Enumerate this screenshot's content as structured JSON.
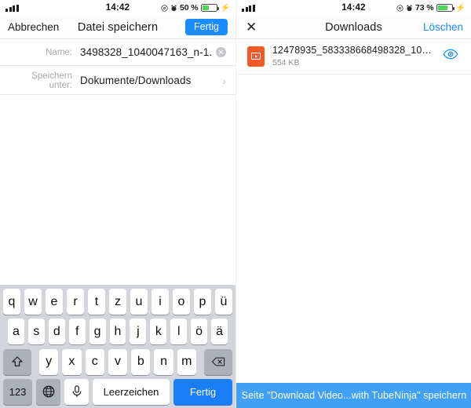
{
  "left": {
    "status": {
      "time": "14:42",
      "battery_pct": "50 %",
      "signal_icon": "signal-bars-icon",
      "location_icon": "location-services-icon",
      "alarm_icon": "alarm-clock-icon",
      "battery_icon": "battery-icon",
      "charging_icon": "charging-bolt-icon"
    },
    "nav": {
      "cancel_label": "Abbrechen",
      "title": "Datei speichern",
      "done_label": "Fertig"
    },
    "form": {
      "name_label": "Name:",
      "name_value": "3498328_1040047163_n-1.",
      "clear_icon": "clear-field-icon",
      "location_label": "Speichern unter:",
      "location_value": "Dokumente/Downloads",
      "chevron_icon": "chevron-right-icon"
    },
    "keyboard": {
      "row1": [
        "q",
        "w",
        "e",
        "r",
        "t",
        "z",
        "u",
        "i",
        "o",
        "p",
        "ü"
      ],
      "row2": [
        "a",
        "s",
        "d",
        "f",
        "g",
        "h",
        "j",
        "k",
        "l",
        "ö",
        "ä"
      ],
      "row3": [
        "y",
        "x",
        "c",
        "v",
        "b",
        "n",
        "m"
      ],
      "shift_icon": "shift-up-arrow-icon",
      "backspace_icon": "backspace-delete-icon",
      "numbers_label": "123",
      "globe_icon": "globe-language-icon",
      "mic_icon": "microphone-icon",
      "space_label": "Leerzeichen",
      "done_label": "Fertig"
    }
  },
  "right": {
    "status": {
      "time": "14:42",
      "battery_pct": "73 %",
      "signal_icon": "signal-bars-icon",
      "location_icon": "location-services-icon",
      "alarm_icon": "alarm-clock-icon",
      "battery_icon": "battery-icon",
      "charging_icon": "charging-bolt-icon"
    },
    "nav": {
      "close_icon": "close-x-icon",
      "title": "Downloads",
      "delete_label": "Löschen"
    },
    "download": {
      "file_icon": "video-file-icon",
      "file_name": "12478935_583338668498328_104...",
      "file_size": "554 KB",
      "preview_icon": "eye-preview-icon"
    },
    "bottom_bar": {
      "label": "Seite \"Download Video...with TubeNinja\" speichern"
    }
  },
  "colors": {
    "accent_blue": "#1a8cff",
    "keyboard_blue": "#1a7ef7",
    "bar_blue": "#3fa0f5",
    "file_orange": "#f4592a",
    "battery_green": "#4cd455"
  }
}
